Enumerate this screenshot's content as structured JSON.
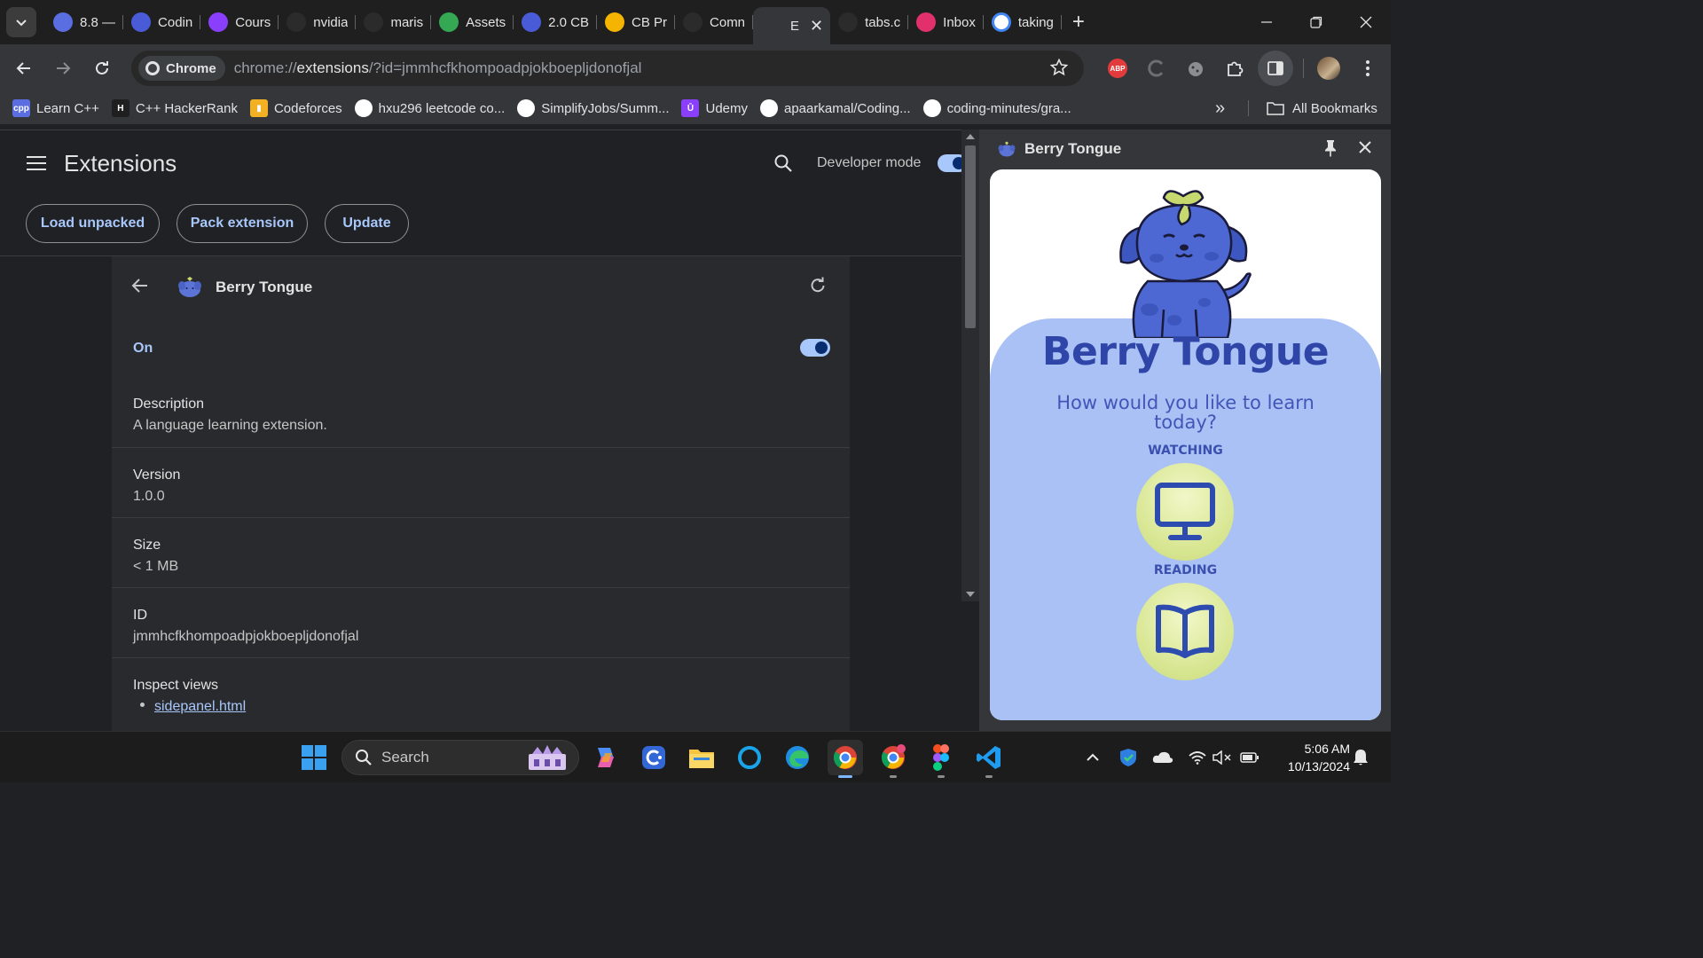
{
  "tabs": [
    {
      "title": "8.8 —",
      "icon": "cpp-favicon",
      "color": "#5b6ee1"
    },
    {
      "title": "Codin",
      "icon": "stack-favicon",
      "color": "#4a5bd8"
    },
    {
      "title": "Cours",
      "icon": "udemy-favicon",
      "color": "#8a3ffc"
    },
    {
      "title": "nvidia",
      "icon": "wattpad-favicon",
      "color": "#2b2b2b"
    },
    {
      "title": "maris",
      "icon": "github-favicon",
      "color": "#2b2b2b"
    },
    {
      "title": "Assets",
      "icon": "drive-favicon",
      "color": "#34a853"
    },
    {
      "title": "2.0 CB",
      "icon": "stack-favicon",
      "color": "#4a5bd8"
    },
    {
      "title": "CB Pr",
      "icon": "slides-favicon",
      "color": "#f4b400"
    },
    {
      "title": "Comn",
      "icon": "github-favicon",
      "color": "#2b2b2b"
    },
    {
      "title": "E",
      "icon": "puzzle-favicon",
      "color": "#35363a",
      "active": true
    },
    {
      "title": "tabs.c",
      "icon": "medium-favicon",
      "color": "#2b2b2b"
    },
    {
      "title": "Inbox",
      "icon": "instagram-favicon",
      "color": "#e1306c"
    },
    {
      "title": "taking",
      "icon": "google-favicon",
      "color": "#ffffff"
    }
  ],
  "toolbar": {
    "chip_label": "Chrome",
    "url_prefix": "chrome://",
    "url_host": "extensions",
    "url_rest": "/?id=jmmhcfkhompoadpjokboepljdonofjal",
    "abp_label": "ABP"
  },
  "bookmarks": [
    {
      "label": "Learn C++",
      "icon": "cpp-icon",
      "color": "#5b6ee1",
      "glyph": "cpp"
    },
    {
      "label": "C++ HackerRank",
      "icon": "hackerrank-icon",
      "color": "#1f1f1f",
      "glyph": "H"
    },
    {
      "label": "Codeforces",
      "icon": "codeforces-icon",
      "color": "#f2b124",
      "glyph": "▮"
    },
    {
      "label": "hxu296 leetcode co...",
      "icon": "github-icon",
      "color": "#ffffff",
      "glyph": ""
    },
    {
      "label": "SimplifyJobs/Summ...",
      "icon": "github-icon",
      "color": "#ffffff",
      "glyph": ""
    },
    {
      "label": "Udemy",
      "icon": "udemy-icon",
      "color": "#8a3ffc",
      "glyph": "Ū"
    },
    {
      "label": "apaarkamal/Coding...",
      "icon": "github-icon",
      "color": "#ffffff",
      "glyph": ""
    },
    {
      "label": "coding-minutes/gra...",
      "icon": "github-icon",
      "color": "#ffffff",
      "glyph": ""
    }
  ],
  "bookmarks_more": "»",
  "all_bookmarks": "All Bookmarks",
  "extensions_page": {
    "title": "Extensions",
    "dev_mode_label": "Developer mode",
    "dev_mode_on": true,
    "buttons": {
      "load": "Load unpacked",
      "pack": "Pack extension",
      "update": "Update"
    },
    "detail": {
      "name": "Berry Tongue",
      "on_label": "On",
      "enabled": true,
      "rows": [
        {
          "label": "Description",
          "value": "A language learning extension."
        },
        {
          "label": "Version",
          "value": "1.0.0"
        },
        {
          "label": "Size",
          "value": "< 1 MB"
        },
        {
          "label": "ID",
          "value": "jmmhcfkhompoadpjokboepljdonofjal"
        }
      ],
      "inspect_label": "Inspect views",
      "inspect_link": "sidepanel.html"
    }
  },
  "side_panel": {
    "header_title": "Berry Tongue",
    "app_title": "Berry Tongue",
    "question": "How would you like to learn today?",
    "options": [
      {
        "label": "WATCHING",
        "icon": "monitor-icon"
      },
      {
        "label": "READING",
        "icon": "book-icon"
      }
    ]
  },
  "taskbar": {
    "search_placeholder": "Search",
    "time": "5:06 AM",
    "date": "10/13/2024"
  }
}
